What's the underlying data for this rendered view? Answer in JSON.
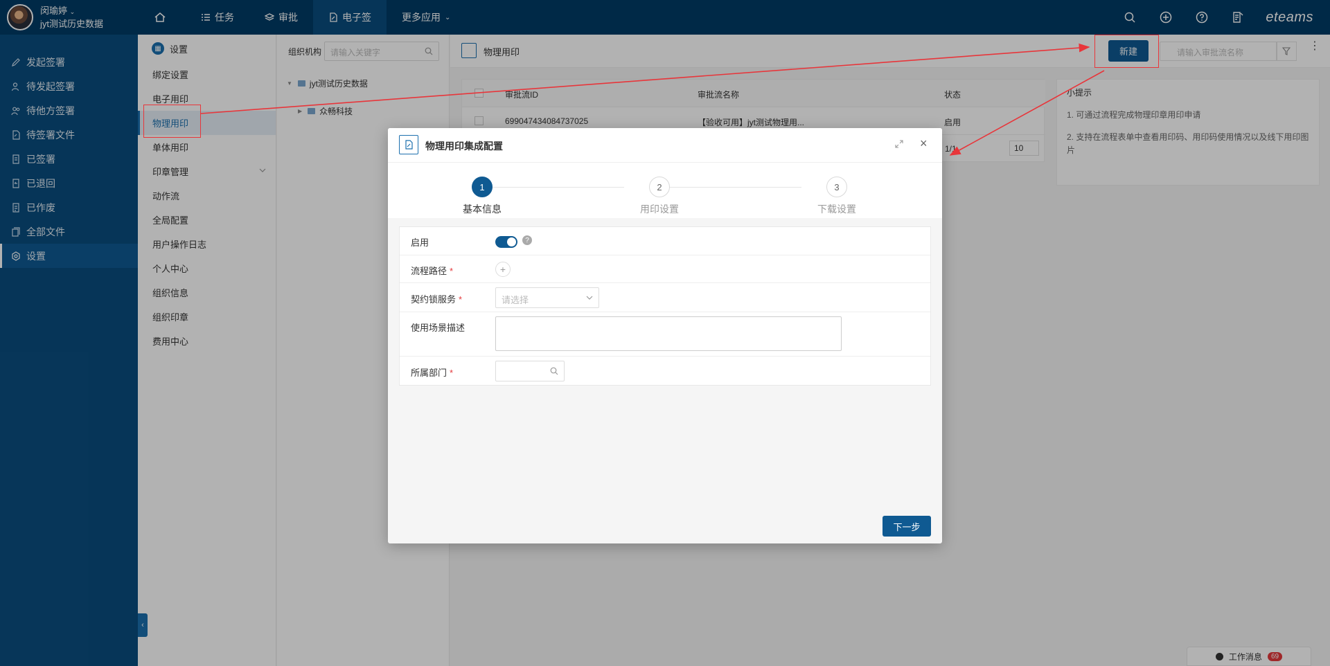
{
  "user": {
    "name": "闵瑜婷",
    "org": "jyt测试历史数据"
  },
  "topnav": {
    "items": [
      {
        "label": "任务"
      },
      {
        "label": "审批"
      },
      {
        "label": "电子签"
      },
      {
        "label": "更多应用"
      }
    ],
    "brand": "eteams"
  },
  "sidebar": {
    "items": [
      {
        "label": "发起签署",
        "icon": "sign-pen-icon"
      },
      {
        "label": "待发起签署",
        "icon": "user-pending-icon"
      },
      {
        "label": "待他方签署",
        "icon": "users-icon"
      },
      {
        "label": "待签署文件",
        "icon": "file-edit-icon"
      },
      {
        "label": "已签署",
        "icon": "file-check-icon"
      },
      {
        "label": "已退回",
        "icon": "return-icon"
      },
      {
        "label": "已作废",
        "icon": "file-void-icon"
      },
      {
        "label": "全部文件",
        "icon": "files-icon"
      },
      {
        "label": "设置",
        "icon": "gear-icon"
      }
    ]
  },
  "settings_menu": {
    "title": "设置",
    "items": [
      {
        "label": "绑定设置"
      },
      {
        "label": "电子用印"
      },
      {
        "label": "物理用印"
      },
      {
        "label": "单体用印"
      },
      {
        "label": "印章管理"
      },
      {
        "label": "动作流"
      },
      {
        "label": "全局配置"
      },
      {
        "label": "用户操作日志"
      },
      {
        "label": "个人中心"
      },
      {
        "label": "组织信息"
      },
      {
        "label": "组织印章"
      },
      {
        "label": "费用中心"
      }
    ]
  },
  "tree": {
    "label": "组织机构",
    "search_placeholder": "请输入关键字",
    "root": "jyt测试历史数据",
    "child": "众畅科技"
  },
  "content": {
    "title": "物理用印",
    "new_button": "新建",
    "search_placeholder": "请输入审批流名称",
    "table": {
      "headers": [
        "审批流ID",
        "审批流名称",
        "状态"
      ],
      "rows": [
        {
          "id": "699047434084737025",
          "name": "【验收可用】jyt测试物理用...",
          "status": "启用"
        }
      ],
      "pager": {
        "page": "1/1",
        "size": "10"
      }
    },
    "tips": {
      "title": "小提示",
      "items": [
        "1. 可通过流程完成物理印章用印申请",
        "2. 支持在流程表单中查看用印码、用印码使用情况以及线下用印图片"
      ]
    }
  },
  "work_message": {
    "label": "工作消息",
    "count": "69"
  },
  "modal": {
    "title": "物理用印集成配置",
    "steps": [
      {
        "num": "1",
        "label": "基本信息"
      },
      {
        "num": "2",
        "label": "用印设置"
      },
      {
        "num": "3",
        "label": "下载设置"
      }
    ],
    "form": {
      "enable_label": "启用",
      "enable_on": true,
      "flow_path_label": "流程路径",
      "contract_service_label": "契约锁服务",
      "contract_service_placeholder": "请选择",
      "scene_label": "使用场景描述",
      "dept_label": "所属部门",
      "required_mark": "*",
      "help_mark": "?",
      "plus_mark": "+"
    },
    "next_button": "下一步"
  },
  "colors": {
    "primary": "#0f5a92",
    "nav_bg": "#013b66",
    "sidebar_bg": "#0a4d7f",
    "annotation": "#e8353a"
  }
}
